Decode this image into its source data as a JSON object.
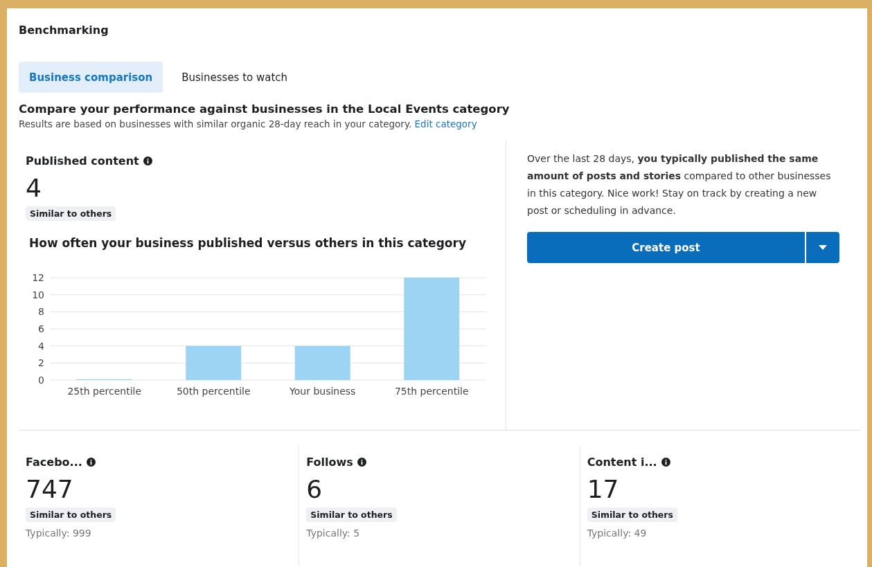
{
  "header": {
    "title": "Benchmarking"
  },
  "tabs": [
    {
      "label": "Business comparison",
      "selected": true
    },
    {
      "label": "Businesses to watch",
      "selected": false
    }
  ],
  "intro": {
    "heading": "Compare your performance against businesses in the Local Events category",
    "description": "Results are based on businesses with similar organic 28-day reach in your category.",
    "link": "Edit category"
  },
  "published": {
    "label": "Published content",
    "value": "4",
    "badge": "Similar to others",
    "chart_title": "How often your business published versus others in this category",
    "chart_data": {
      "type": "bar",
      "categories": [
        "25th percentile",
        "50th percentile",
        "Your business",
        "75th percentile"
      ],
      "series": [
        {
          "color": "#9dd4f3",
          "values": [
            0.1,
            4,
            4,
            12
          ]
        }
      ],
      "grid": true,
      "ylim": [
        0,
        12
      ],
      "yticks": [
        0,
        2,
        4,
        6,
        8,
        10,
        12
      ]
    }
  },
  "advice": {
    "text": "Over the last 28 days, **you typically published the same amount of posts and stories** compared to other businesses in this category. Nice work! Stay on track by creating a new post or scheduling in advance.",
    "button": "Create post"
  },
  "stats": [
    {
      "label": "Facebo...",
      "value": "747",
      "badge": "Similar to others",
      "typical": "Typically: 999"
    },
    {
      "label": "Follows",
      "value": "6",
      "badge": "Similar to others",
      "typical": "Typically: 5"
    },
    {
      "label": "Content i...",
      "value": "17",
      "badge": "Similar to others",
      "typical": "Typically: 49"
    }
  ]
}
